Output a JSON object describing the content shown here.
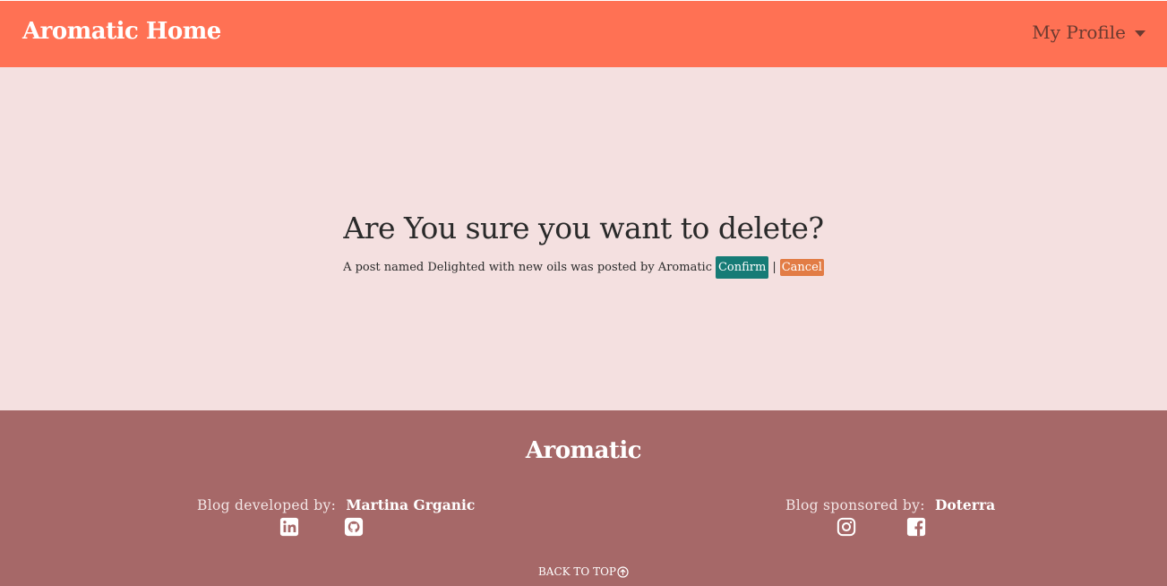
{
  "nav": {
    "brand": "Aromatic Home",
    "profile_label": "My Profile"
  },
  "main": {
    "heading": "Are You sure you want to delete?",
    "message": "A post named Delighted with new oils was posted by Aromatic",
    "confirm_label": "Confirm",
    "separator": "|",
    "cancel_label": "Cancel"
  },
  "footer": {
    "title": "Aromatic",
    "developed_label": "Blog developed by:",
    "developer": "Martina Grganic",
    "sponsored_label": "Blog sponsored by:",
    "sponsor": "Doterra",
    "back_to_top": "BACK TO TOP",
    "icons": [
      "linkedin-icon",
      "github-icon",
      "instagram-icon",
      "facebook-icon",
      "arrow-up-circle-icon"
    ]
  },
  "colors": {
    "navbar": "#ff7154",
    "page_background": "#f4e0e0",
    "footer": "#a66868",
    "confirm_button": "#167b76",
    "cancel_button": "#e27c45"
  }
}
